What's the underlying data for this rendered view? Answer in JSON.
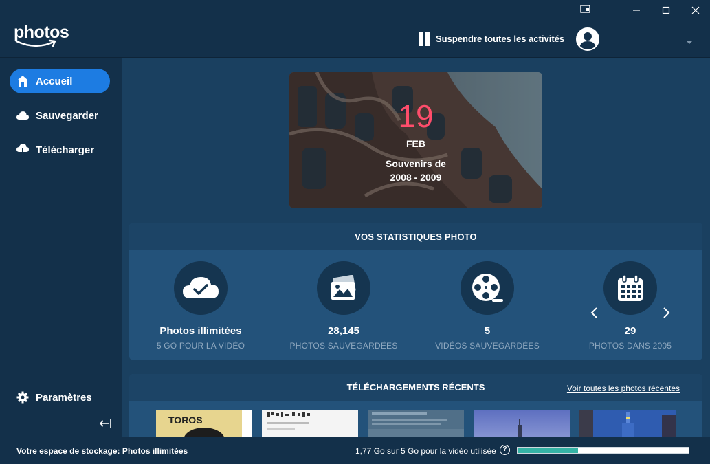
{
  "app": {
    "logo_text": "photos"
  },
  "header": {
    "pause_all_label": "Suspendre toutes les activités",
    "user_name": ""
  },
  "sidebar": {
    "items": [
      {
        "label": "Accueil",
        "icon": "home-icon",
        "active": true
      },
      {
        "label": "Sauvegarder",
        "icon": "cloud-icon",
        "active": false
      },
      {
        "label": "Télécharger",
        "icon": "cloud-download-icon",
        "active": false
      }
    ],
    "settings_label": "Paramètres"
  },
  "memory": {
    "day": "19",
    "month": "FEB",
    "line1": "Souvenirs de",
    "line2": "2008 - 2009"
  },
  "stats": {
    "title": "VOS STATISTIQUES PHOTO",
    "items": [
      {
        "value": "Photos illimitées",
        "caption": "5 GO POUR LA VIDÉO",
        "icon": "cloud-check-icon"
      },
      {
        "value": "28,145",
        "caption": "PHOTOS SAUVEGARDÉES",
        "icon": "photo-icon"
      },
      {
        "value": "5",
        "caption": "VIDÉOS SAUVEGARDÉES",
        "icon": "film-reel-icon"
      },
      {
        "value": "29",
        "caption": "PHOTOS DANS 2005",
        "icon": "calendar-icon"
      }
    ]
  },
  "uploads": {
    "title": "TÉLÉCHARGEMENTS RÉCENTS",
    "see_all_label": "Voir toutes les photos récentes",
    "thumbs": [
      {
        "text": "TOROS"
      },
      {
        "text": ""
      },
      {
        "text": ""
      },
      {
        "text": ""
      },
      {
        "text": ""
      }
    ]
  },
  "footer": {
    "storage_label": "Votre espace de stockage: Photos illimitées",
    "usage_text": "1,77 Go sur 5 Go pour la vidéo utilisée",
    "help_label": "?",
    "usage_fraction": 0.354
  },
  "colors": {
    "accent": "#1d7ce2",
    "memory_day": "#ff4d6b",
    "storage_fill": "#35b3a6"
  }
}
